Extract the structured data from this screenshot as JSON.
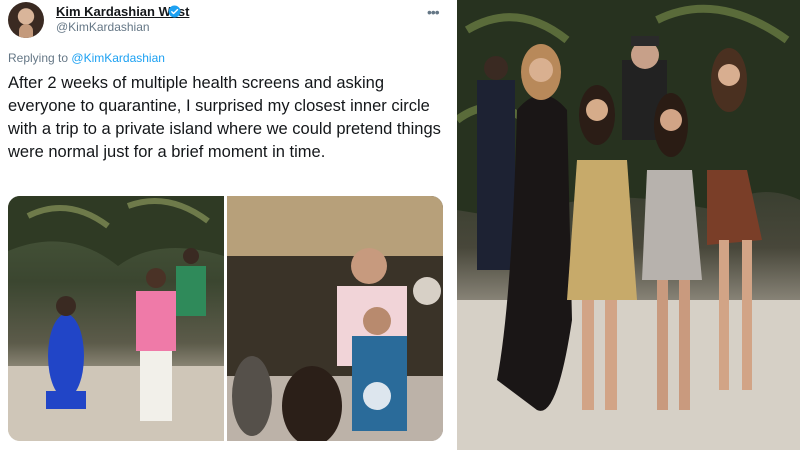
{
  "tweet": {
    "display_name": "Kim Kardashian West",
    "handle": "@KimKardashian",
    "replying_prefix": "Replying to",
    "replying_to": "@KimKardashian",
    "text": "After 2 weeks of multiple health screens and asking everyone to quarantine, I surprised my closest inner circle with a trip to a private island where we could pretend things were normal just for a brief moment in time.",
    "more_icon": "more-options-icon",
    "verified_icon": "verified-badge-icon"
  },
  "colors": {
    "link": "#1da1f2",
    "secondary_text": "#657786",
    "verified": "#1da1f2"
  }
}
